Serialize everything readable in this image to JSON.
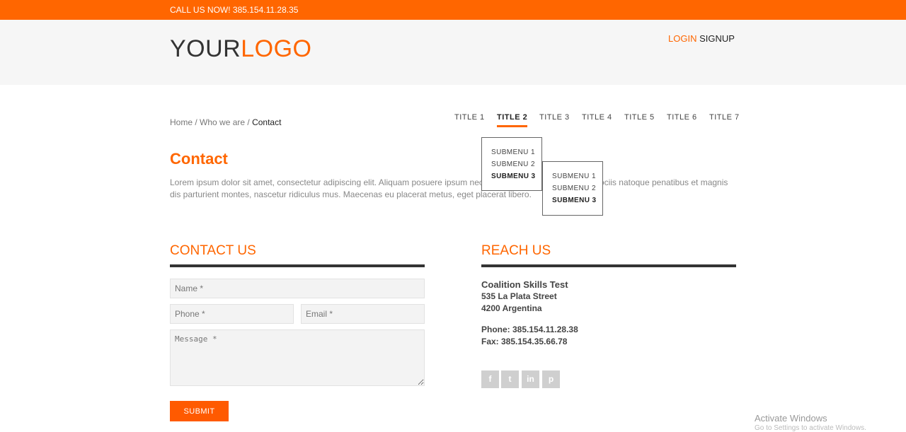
{
  "topbar": {
    "call": "CALL US NOW! 385.154.11.28.35"
  },
  "auth": {
    "login": "LOGIN",
    "signup": "SIGNUP"
  },
  "logo": {
    "part1": "YOUR",
    "part2": "LOGO"
  },
  "breadcrumb": {
    "home": "Home",
    "sep1": " / ",
    "who": "Who we are",
    "sep2": " / ",
    "current": "Contact"
  },
  "nav": {
    "items": [
      "TITLE 1",
      "TITLE 2",
      "TITLE 3",
      "TITLE 4",
      "TITLE 5",
      "TITLE 6",
      "TITLE 7"
    ],
    "active_index": 1
  },
  "submenu1": [
    "SUBMENU 1",
    "SUBMENU 2",
    "SUBMENU 3"
  ],
  "submenu2": [
    "SUBMENU 1",
    "SUBMENU 2",
    "SUBMENU 3"
  ],
  "page": {
    "title": "Contact",
    "lorem": "Lorem ipsum dolor sit amet, consectetur adipiscing elit. Aliquam posuere ipsum nec velit mattis elementum. Cum sociis natoque penatibus et magnis dis parturient montes, nascetur ridiculus mus. Maecenas eu placerat metus, eget placerat libero."
  },
  "contact": {
    "title": "CONTACT US",
    "name_placeholder": "Name *",
    "phone_placeholder": "Phone *",
    "email_placeholder": "Email *",
    "message_placeholder": "Message *",
    "submit": "SUBMIT"
  },
  "reach": {
    "title": "REACH US",
    "company": "Coalition Skills Test",
    "street": "535 La Plata Street",
    "city": "4200 Argentina",
    "phone": "Phone: 385.154.11.28.38",
    "fax": "Fax: 385.154.35.66.78"
  },
  "social": [
    {
      "icon": "facebook-icon",
      "glyph": "f"
    },
    {
      "icon": "twitter-icon",
      "glyph": "t"
    },
    {
      "icon": "linkedin-icon",
      "glyph": "in"
    },
    {
      "icon": "pinterest-icon",
      "glyph": "p"
    }
  ],
  "watermark": {
    "line1": "Activate Windows",
    "line2": "Go to Settings to activate Windows."
  },
  "colors": {
    "accent": "#ff6600",
    "header_bg": "#f6f6f6",
    "dark": "#333333"
  }
}
